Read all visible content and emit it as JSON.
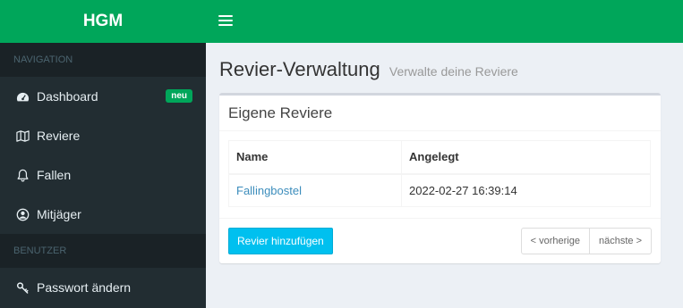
{
  "brand": "HGM",
  "sidebar": {
    "section_navigation": "NAVIGATION",
    "items": [
      {
        "label": "Dashboard",
        "icon": "dashboard-icon",
        "badge": "neu"
      },
      {
        "label": "Reviere",
        "icon": "map-icon"
      },
      {
        "label": "Fallen",
        "icon": "bell-icon"
      },
      {
        "label": "Mitjäger",
        "icon": "user-circle-icon"
      }
    ],
    "section_user": "BENUTZER",
    "user_items": [
      {
        "label": "Passwort ändern",
        "icon": "key-icon"
      }
    ]
  },
  "page": {
    "title": "Revier-Verwaltung",
    "subtitle": "Verwalte deine Reviere"
  },
  "box": {
    "title": "Eigene Reviere",
    "table": {
      "headers": [
        "Name",
        "Angelegt"
      ],
      "rows": [
        [
          "Fallingbostel",
          "2022-02-27 16:39:14"
        ]
      ]
    },
    "add_button": "Revier hinzufügen",
    "pager": {
      "prev": "< vorherige",
      "next": "nächste >"
    }
  },
  "colors": {
    "accent": "#00a65a",
    "sidebar": "#222d32",
    "button": "#00c0ef",
    "link": "#3c8dbc"
  }
}
